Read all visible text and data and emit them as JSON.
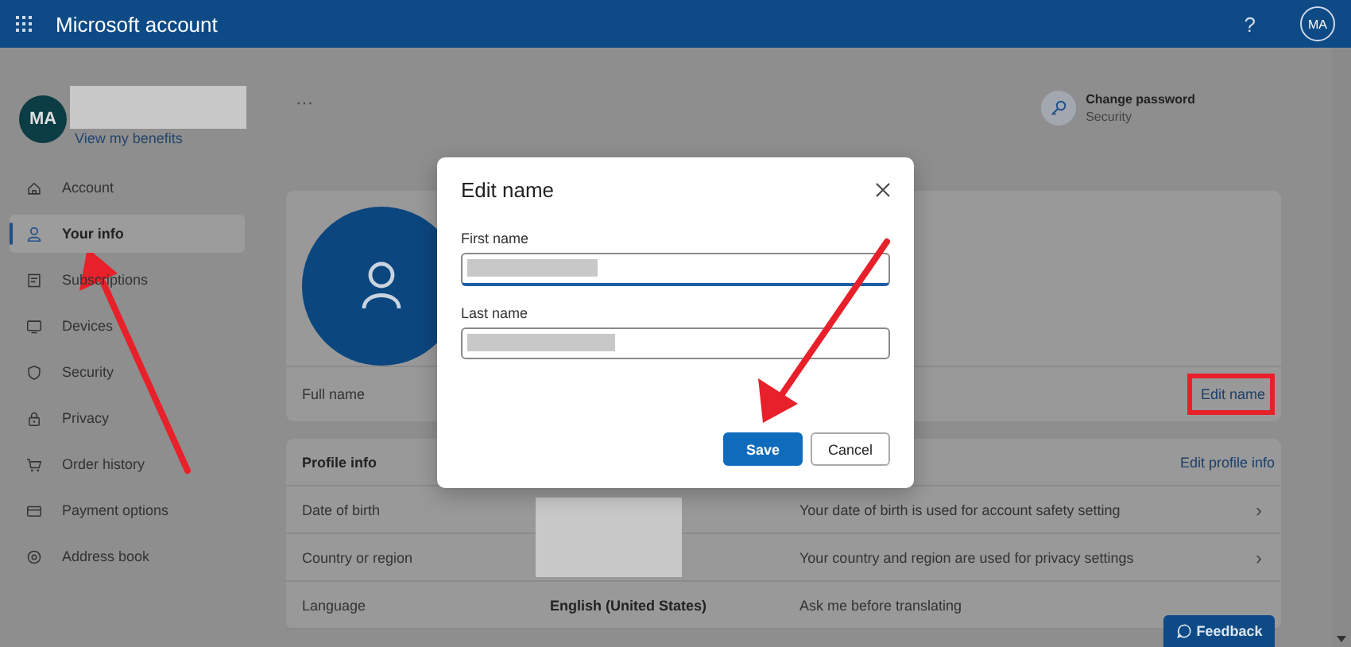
{
  "header": {
    "title": "Microsoft account",
    "help": "?",
    "avatar": "MA"
  },
  "sidebar": {
    "avatar": "MA",
    "benefits_link": "View my benefits",
    "items": [
      {
        "label": "Account",
        "selected": false
      },
      {
        "label": "Your info",
        "selected": true
      },
      {
        "label": "Subscriptions",
        "selected": false
      },
      {
        "label": "Devices",
        "selected": false
      },
      {
        "label": "Security",
        "selected": false
      },
      {
        "label": "Privacy",
        "selected": false
      },
      {
        "label": "Order history",
        "selected": false
      },
      {
        "label": "Payment options",
        "selected": false
      },
      {
        "label": "Address book",
        "selected": false
      }
    ]
  },
  "main": {
    "more": "···",
    "change_password": {
      "title": "Change password",
      "subtitle": "Security"
    },
    "full_name": {
      "label": "Full name",
      "action": "Edit name"
    },
    "profile_info": {
      "title": "Profile info",
      "action": "Edit profile info",
      "rows": [
        {
          "label": "Date of birth",
          "description": "Your date of birth is used for account safety setting",
          "chevron": "›"
        },
        {
          "label": "Country or region",
          "description": "Your country and region are used for privacy settings",
          "chevron": "›"
        },
        {
          "label": "Language",
          "value": "English (United States)",
          "description": "Ask me before translating"
        }
      ]
    },
    "feedback": "Feedback"
  },
  "dialog": {
    "title": "Edit name",
    "fields": [
      {
        "label": "First name"
      },
      {
        "label": "Last name"
      }
    ],
    "buttons": [
      {
        "label": "Save",
        "kind": "primary"
      },
      {
        "label": "Cancel",
        "kind": "secondary"
      }
    ]
  }
}
